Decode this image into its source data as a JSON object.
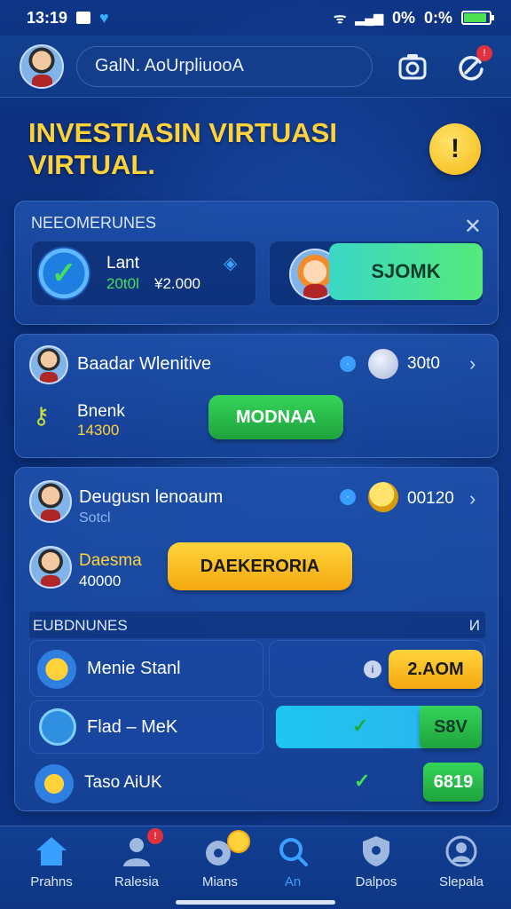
{
  "status_bar": {
    "time": "13:19",
    "signal_text": "0%",
    "battery_text": "0:%"
  },
  "header": {
    "search_text": "GalN. AoUrpliuooA"
  },
  "hero": {
    "title": "INVESTIASIN VIRTUASI VIRTUAL.",
    "badge": "!"
  },
  "recommend_card": {
    "section": "NEEOMERUNES",
    "item_title": "Lant",
    "item_value_green": "20t0l",
    "item_value": "¥2.000",
    "button": "SJOMK"
  },
  "card2": {
    "title": "Baadar Wlenitive",
    "value": "30t0",
    "sub_title": "Bnenk",
    "sub_value": "14300",
    "button": "MODNAA"
  },
  "card3": {
    "title": "Deugusn lenoaum",
    "subtitle": "Sotcl",
    "value": "00120",
    "person_title": "Daesma",
    "person_value": "40000",
    "button": "DAEKERORIA",
    "section": "EUBDNUNES",
    "section_right": "И",
    "rows": [
      {
        "label": "Menie Stanl",
        "button": "2.AOM"
      },
      {
        "label": "Flad – MeK",
        "button": "S8V"
      },
      {
        "label": "Taso AiUK",
        "button": "6819"
      }
    ]
  },
  "nav": [
    {
      "label": "Prahns",
      "icon": "home-icon"
    },
    {
      "label": "Ralesia",
      "icon": "person-icon",
      "badge": "!"
    },
    {
      "label": "Mians",
      "icon": "location-icon"
    },
    {
      "label": "An",
      "icon": "search-icon"
    },
    {
      "label": "Dalpos",
      "icon": "shield-icon"
    },
    {
      "label": "Slepala",
      "icon": "user-icon"
    }
  ],
  "colors": {
    "accent_yellow": "#ffd23a",
    "accent_green": "#35d459",
    "background": "#0c2a6b"
  }
}
